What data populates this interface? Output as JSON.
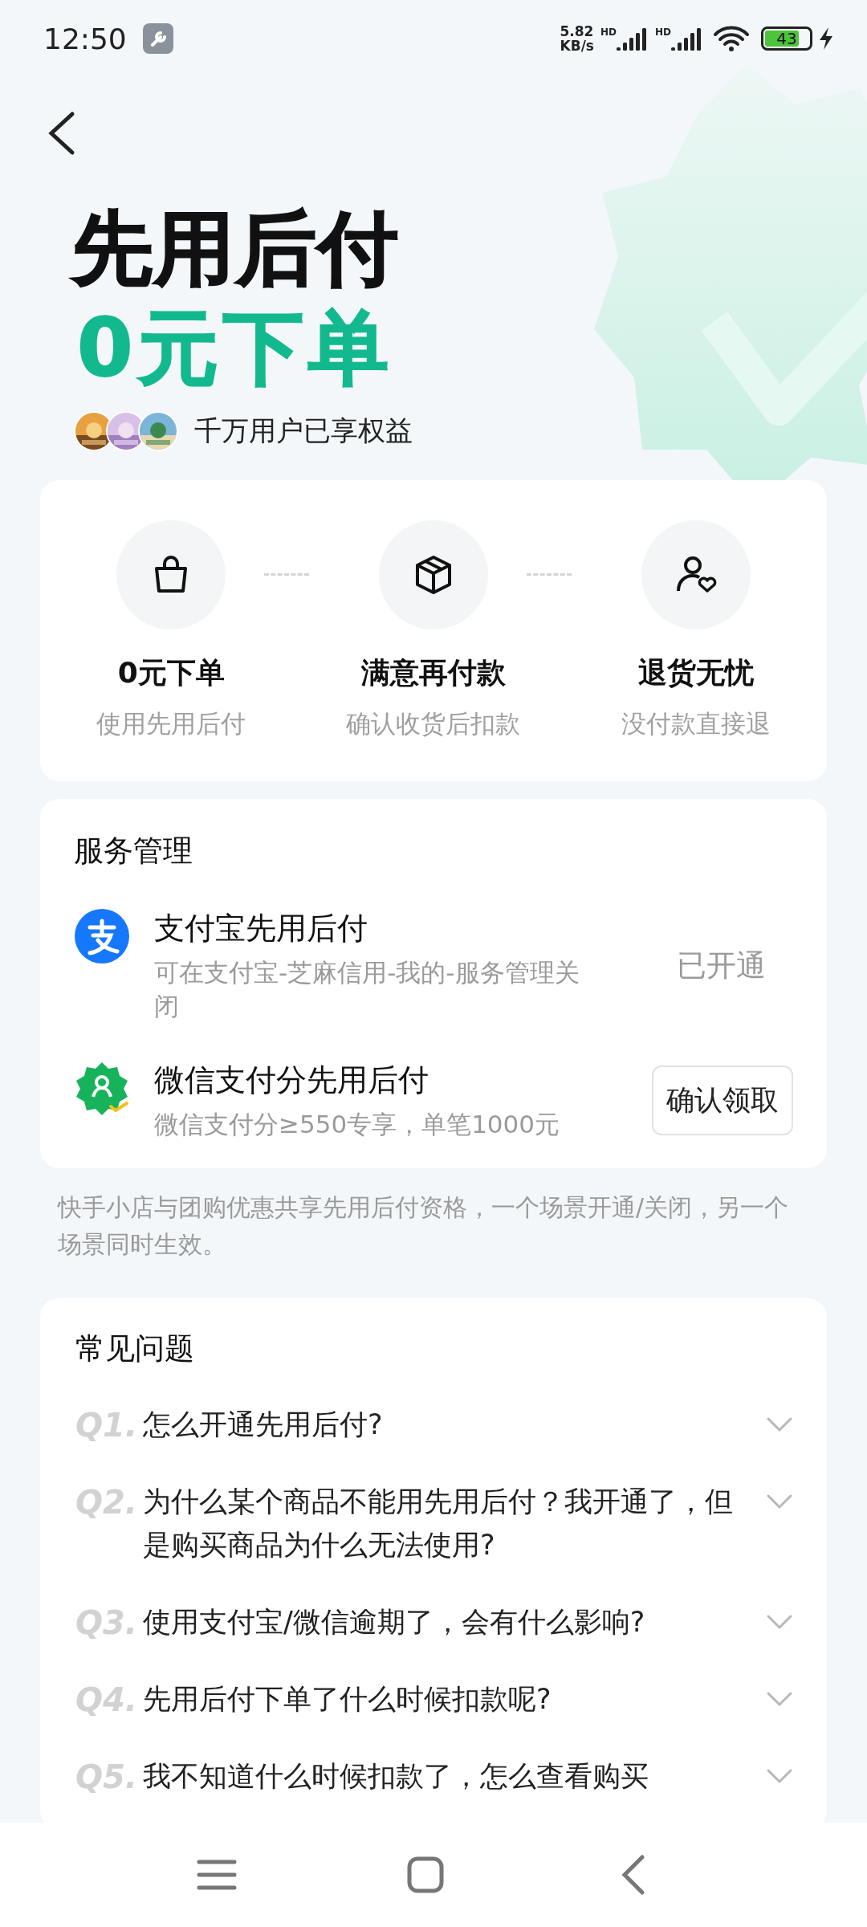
{
  "status_bar": {
    "time": "12:50",
    "speed_value": "5.82",
    "speed_unit": "KB/s",
    "sims": [
      "HD",
      "HD"
    ],
    "battery": "43",
    "charging": true
  },
  "hero": {
    "title": "先用后付",
    "subtitle": "0元下单",
    "users_text": "千万用户已享权益"
  },
  "features": [
    {
      "title": "0元下单",
      "desc": "使用先用后付"
    },
    {
      "title": "满意再付款",
      "desc": "确认收货后扣款"
    },
    {
      "title": "退货无忧",
      "desc": "没付款直接退"
    }
  ],
  "service": {
    "title": "服务管理",
    "items": [
      {
        "name": "支付宝先用后付",
        "desc": "可在支付宝-芝麻信用-我的-服务管理关闭",
        "action": "已开通",
        "kind": "status"
      },
      {
        "name": "微信支付分先用后付",
        "desc": "微信支付分≥550专享，单笔1000元",
        "action": "确认领取",
        "kind": "button"
      }
    ]
  },
  "note": "快手小店与团购优惠共享先用后付资格，一个场景开通/关闭，另一个场景同时生效。",
  "faq": {
    "title": "常见问题",
    "items": [
      {
        "number": "Q1.",
        "question": "怎么开通先用后付?",
        "expanded": false
      },
      {
        "number": "Q2.",
        "question": "为什么某个商品不能用先用后付？我开通了，但是购买商品为什么无法使用?",
        "expanded": false
      },
      {
        "number": "Q3.",
        "question": "使用支付宝/微信逾期了，会有什么影响?",
        "expanded": false
      },
      {
        "number": "Q4.",
        "question": "先用后付下单了什么时候扣款呢?",
        "expanded": false
      },
      {
        "number": "Q5.",
        "question": "我不知道什么时候扣款了，怎么查看购买",
        "expanded": false
      }
    ]
  }
}
